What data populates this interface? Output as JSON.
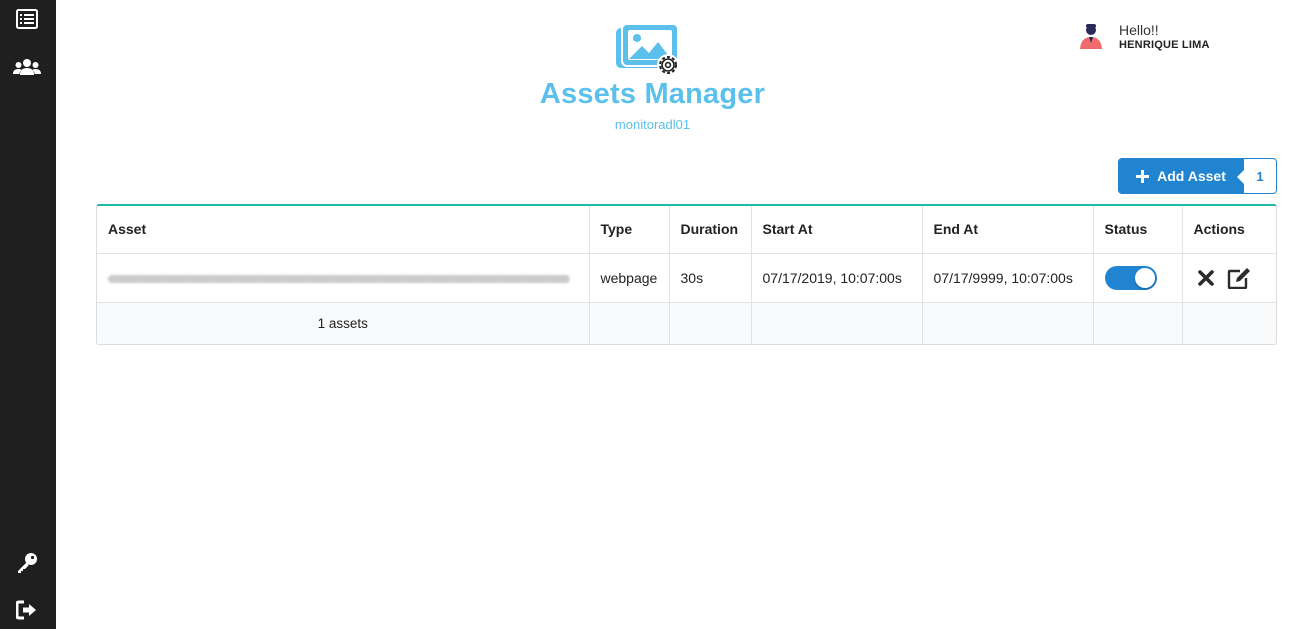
{
  "sidebar": {
    "items": [
      {
        "icon": "list-icon"
      },
      {
        "icon": "users-icon"
      },
      {
        "icon": "key-icon"
      },
      {
        "icon": "logout-icon"
      }
    ]
  },
  "header": {
    "title": "Assets Manager",
    "subtitle": "monitoradl01",
    "logo_icon": "image-settings-icon"
  },
  "user": {
    "greeting": "Hello!!",
    "name": "HENRIQUE LIMA"
  },
  "add_button": {
    "label": "Add Asset",
    "count": "1"
  },
  "table": {
    "columns": [
      "Asset",
      "Type",
      "Duration",
      "Start At",
      "End At",
      "Status",
      "Actions"
    ],
    "rows": [
      {
        "asset": "",
        "type": "webpage",
        "duration": "30s",
        "start_at": "07/17/2019, 10:07:00s",
        "end_at": "07/17/9999, 10:07:00s",
        "status_enabled": true
      }
    ],
    "footer": "1 assets"
  },
  "colors": {
    "accent": "#2184d0",
    "title": "#5bc0eb",
    "sidebar": "#1f1f1f",
    "table_top": "#1fb7a6"
  }
}
